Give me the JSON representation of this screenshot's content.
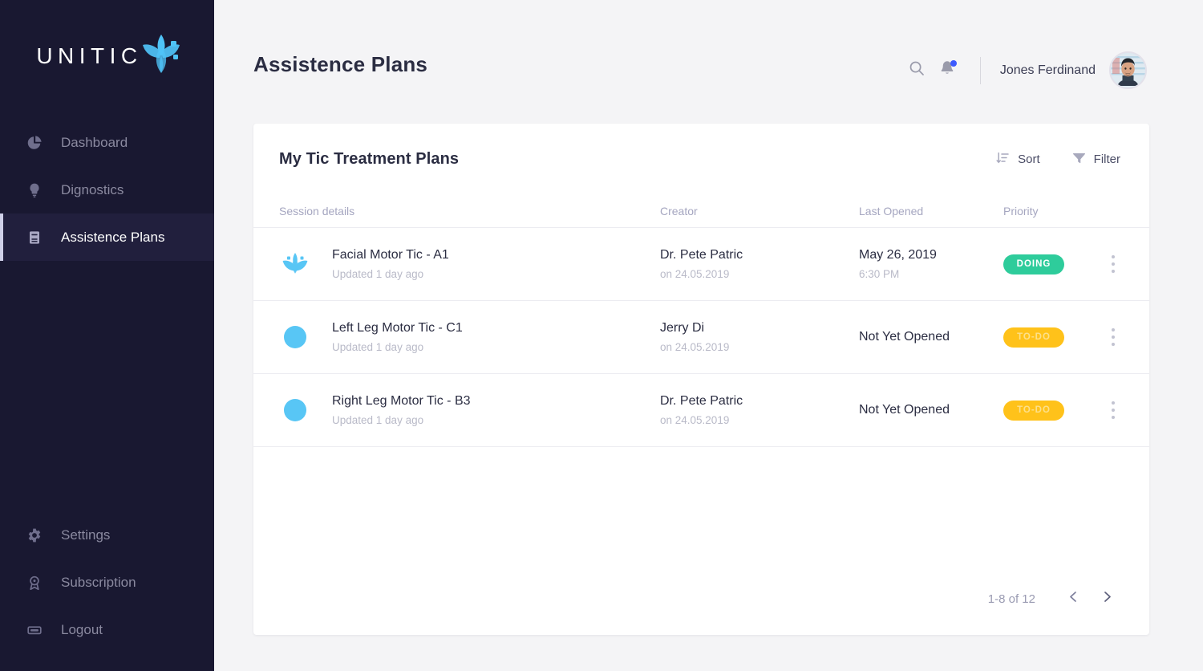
{
  "brand": {
    "name": "UNITIC",
    "logo_icon": "lotus-icon",
    "accent": "#58c6f5",
    "sidebar_bg": "#191831"
  },
  "sidebar": {
    "top_items": [
      {
        "label": "Dashboard",
        "icon": "pie-chart-icon",
        "active": false
      },
      {
        "label": "Dignostics",
        "icon": "lightbulb-icon",
        "active": false
      },
      {
        "label": "Assistence Plans",
        "icon": "book-icon",
        "active": true
      }
    ],
    "bottom_items": [
      {
        "label": "Settings",
        "icon": "gear-icon"
      },
      {
        "label": "Subscription",
        "icon": "award-icon"
      },
      {
        "label": "Logout",
        "icon": "logout-icon"
      }
    ]
  },
  "header": {
    "title": "Assistence Plans",
    "search_icon": "search-icon",
    "bell_icon": "bell-icon",
    "has_notification": true,
    "notification_color": "#3d5afe",
    "user_name": "Jones Ferdinand",
    "avatar_icon": "user-avatar"
  },
  "card": {
    "title": "My Tic Treatment Plans",
    "actions": [
      {
        "label": "Sort",
        "icon": "sort-icon"
      },
      {
        "label": "Filter",
        "icon": "filter-icon"
      }
    ],
    "columns": [
      "Session details",
      "Creator",
      "Last Opened",
      "Priority"
    ],
    "rows": [
      {
        "icon": "lotus-icon",
        "title": "Facial Motor Tic - A1",
        "subtitle": "Updated 1 day ago",
        "creator": "Dr. Pete Patric",
        "creator_date": "on 24.05.2019",
        "last_opened": "May 26, 2019",
        "last_opened_time": "6:30 PM",
        "priority": "DOING",
        "priority_kind": "doing",
        "menu_icon": "kebab-menu-icon"
      },
      {
        "icon": "circle-icon",
        "title": "Left Leg Motor Tic - C1",
        "subtitle": "Updated 1 day ago",
        "creator": "Jerry Di",
        "creator_date": "on 24.05.2019",
        "last_opened": "Not Yet Opened",
        "last_opened_time": "",
        "priority": "TO-DO",
        "priority_kind": "todo",
        "menu_icon": "kebab-menu-icon"
      },
      {
        "icon": "circle-icon",
        "title": "Right Leg Motor Tic - B3",
        "subtitle": "Updated 1 day ago",
        "creator": "Dr. Pete Patric",
        "creator_date": "on 24.05.2019",
        "last_opened": "Not Yet Opened",
        "last_opened_time": "",
        "priority": "TO-DO",
        "priority_kind": "todo",
        "menu_icon": "kebab-menu-icon"
      }
    ],
    "pagination": {
      "label": "1-8 of 12",
      "prev_icon": "chevron-left-icon",
      "next_icon": "chevron-right-icon"
    }
  },
  "colors": {
    "badge_doing": "#2ecc9b",
    "badge_todo": "#ffc21a",
    "page_bg": "#f4f4f6",
    "card_bg": "#ffffff"
  }
}
